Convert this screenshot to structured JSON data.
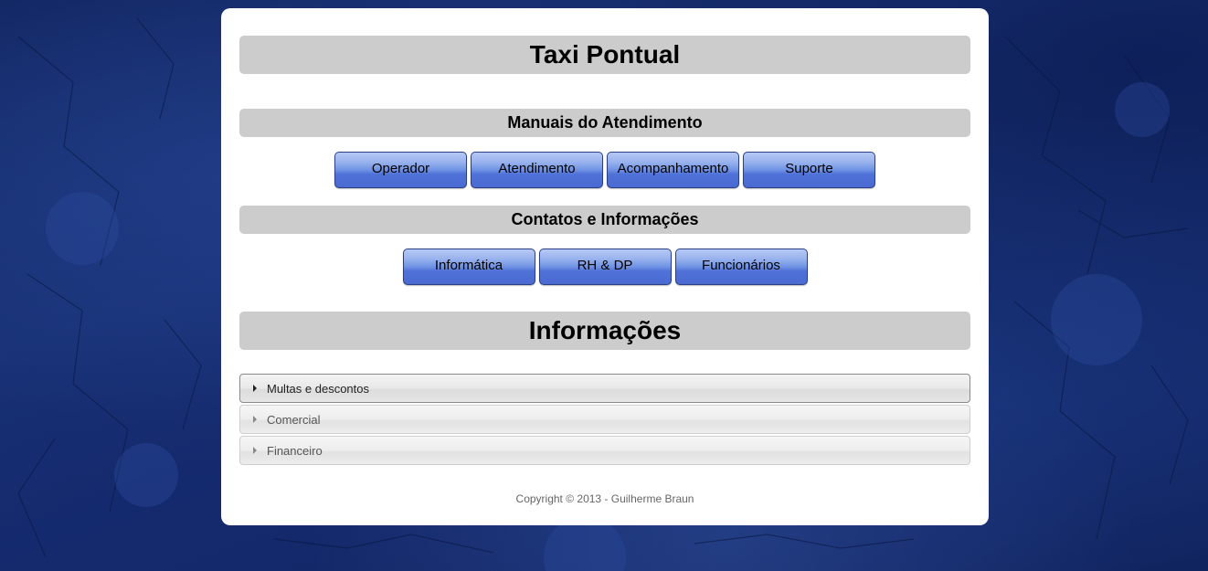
{
  "header": {
    "title": "Taxi Pontual"
  },
  "manuais": {
    "heading": "Manuais do Atendimento",
    "buttons": [
      "Operador",
      "Atendimento",
      "Acompanhamento",
      "Suporte"
    ]
  },
  "contatos": {
    "heading": "Contatos e Informações",
    "buttons": [
      "Informática",
      "RH & DP",
      "Funcionários"
    ]
  },
  "informacoes": {
    "heading": "Informações",
    "accordion": [
      {
        "label": "Multas e descontos",
        "active": true
      },
      {
        "label": "Comercial",
        "active": false
      },
      {
        "label": "Financeiro",
        "active": false
      }
    ]
  },
  "footer": {
    "copyright": "Copyright © 2013 - Guilherme Braun"
  },
  "colors": {
    "button_blue": "#4f72d8",
    "bar_gray": "#cccccc",
    "background_blue": "#1a3478"
  },
  "icons": {
    "accordion_marker": "triangle-right-icon"
  }
}
